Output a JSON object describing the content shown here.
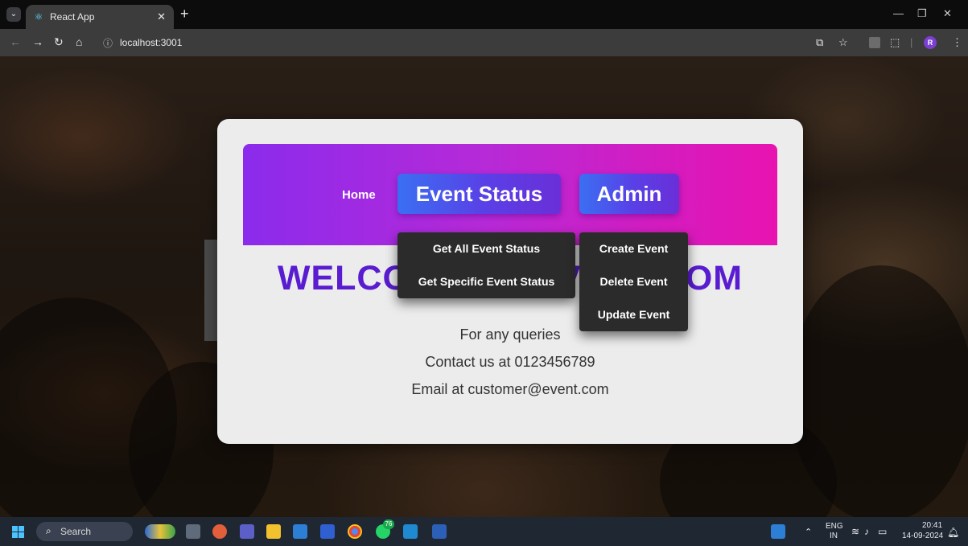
{
  "browser": {
    "tab_title": "React App",
    "url": "localhost:3001",
    "profile_initial": "R"
  },
  "navbar": {
    "home": "Home",
    "event_status": "Event Status",
    "admin": "Admin"
  },
  "event_menu": [
    "Get All Event Status",
    "Get Specific Event Status"
  ],
  "admin_menu": [
    "Create Event",
    "Delete Event",
    "Update Event"
  ],
  "welcome": "WELCOME TO EVENT.COM",
  "info": {
    "queries": "For any queries",
    "contact": "Contact us at 0123456789",
    "email": "Email at customer@event.com"
  },
  "taskbar": {
    "search": "Search",
    "chat_badge": "76",
    "lang": "ENG",
    "region": "IN",
    "time": "20:41",
    "date": "14-09-2024"
  },
  "colors": {
    "navbar_from": "#8b2bec",
    "navbar_to": "#e813b0",
    "welcome": "#5a1cd0",
    "dropdown_bg": "#2b2b2b"
  }
}
